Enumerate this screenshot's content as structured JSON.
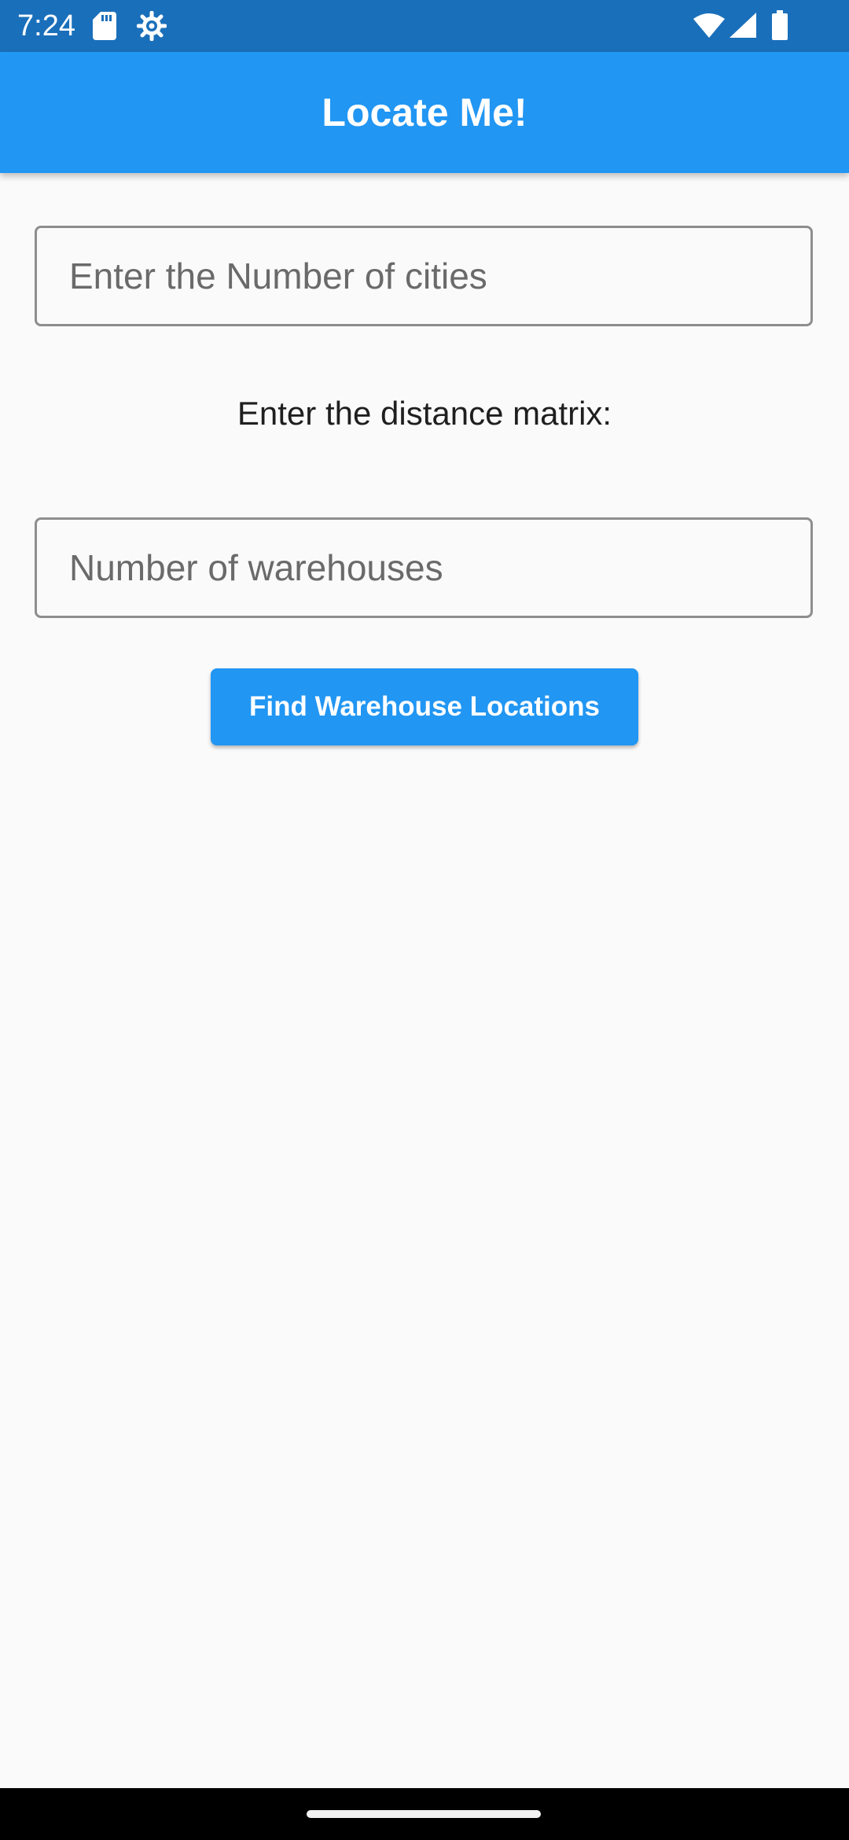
{
  "status_bar": {
    "time": "7:24",
    "left_icons": [
      "sd-card-icon",
      "settings-gear-icon"
    ],
    "right_icons": [
      "wifi-icon",
      "cellular-signal-icon",
      "battery-icon"
    ]
  },
  "app_bar": {
    "title": "Locate Me!"
  },
  "form": {
    "cities_field": {
      "value": "",
      "placeholder": "Enter the Number of cities"
    },
    "matrix_label": "Enter the distance matrix:",
    "warehouses_field": {
      "value": "",
      "placeholder": "Number of warehouses"
    },
    "submit_button_label": "Find Warehouse Locations"
  },
  "colors": {
    "status_bar": "#1a6fba",
    "primary": "#2196f3",
    "background": "#fafafa",
    "field_border": "#8e8e8e",
    "nav_bar": "#000000"
  }
}
